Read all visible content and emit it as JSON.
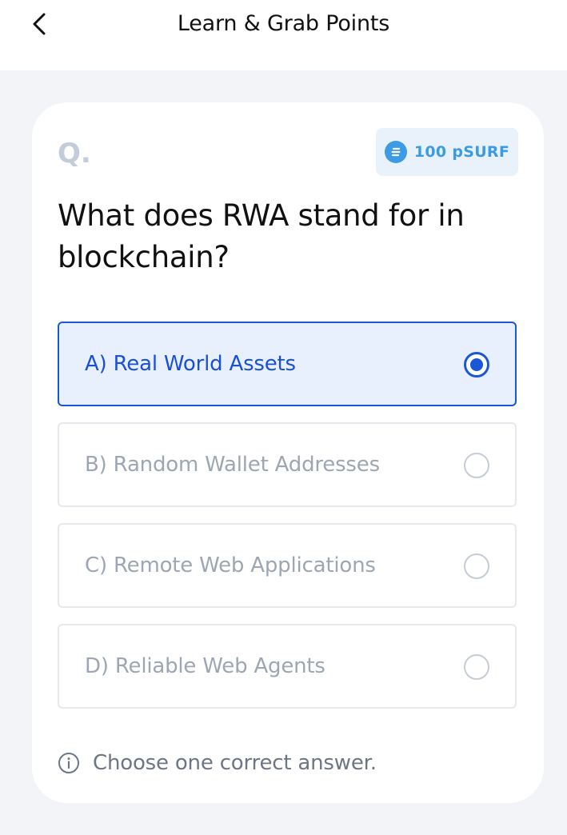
{
  "header": {
    "title": "Learn & Grab Points",
    "back_icon": "chevron-left-icon"
  },
  "quiz": {
    "q_label": "Q.",
    "reward": {
      "icon": "psurf-coin-icon",
      "label": "100 pSURF",
      "color": "#3b9be5"
    },
    "question": "What does RWA stand for in blockchain?",
    "options": [
      {
        "label": "A) Real World Assets",
        "selected": true
      },
      {
        "label": "B) Random Wallet Addresses",
        "selected": false
      },
      {
        "label": "C) Remote Web Applications",
        "selected": false
      },
      {
        "label": "D) Reliable Web Agents",
        "selected": false
      }
    ],
    "hint": {
      "icon": "info-icon",
      "text": "Choose one correct answer."
    }
  },
  "colors": {
    "accent": "#1a56d8",
    "selected_bg": "#e8effd",
    "page_bg": "#f2f4f8"
  }
}
